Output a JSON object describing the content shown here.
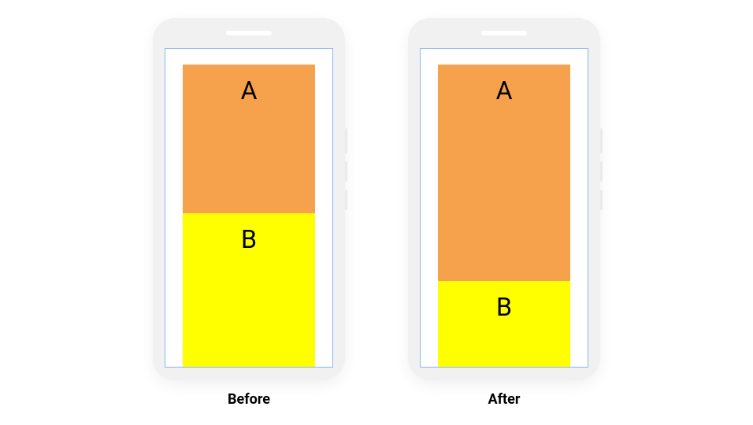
{
  "diagram": {
    "phones": [
      {
        "caption": "Before",
        "blocks": {
          "a": {
            "label": "A",
            "height_percent": 48,
            "color": "#f6a24c"
          },
          "b": {
            "label": "B",
            "height_percent": 52,
            "color": "#ffff00"
          }
        }
      },
      {
        "caption": "After",
        "blocks": {
          "a": {
            "label": "A",
            "height_percent": 70,
            "color": "#f6a24c"
          },
          "b": {
            "label": "B",
            "height_percent": 30,
            "color": "#ffff00"
          }
        }
      }
    ]
  }
}
